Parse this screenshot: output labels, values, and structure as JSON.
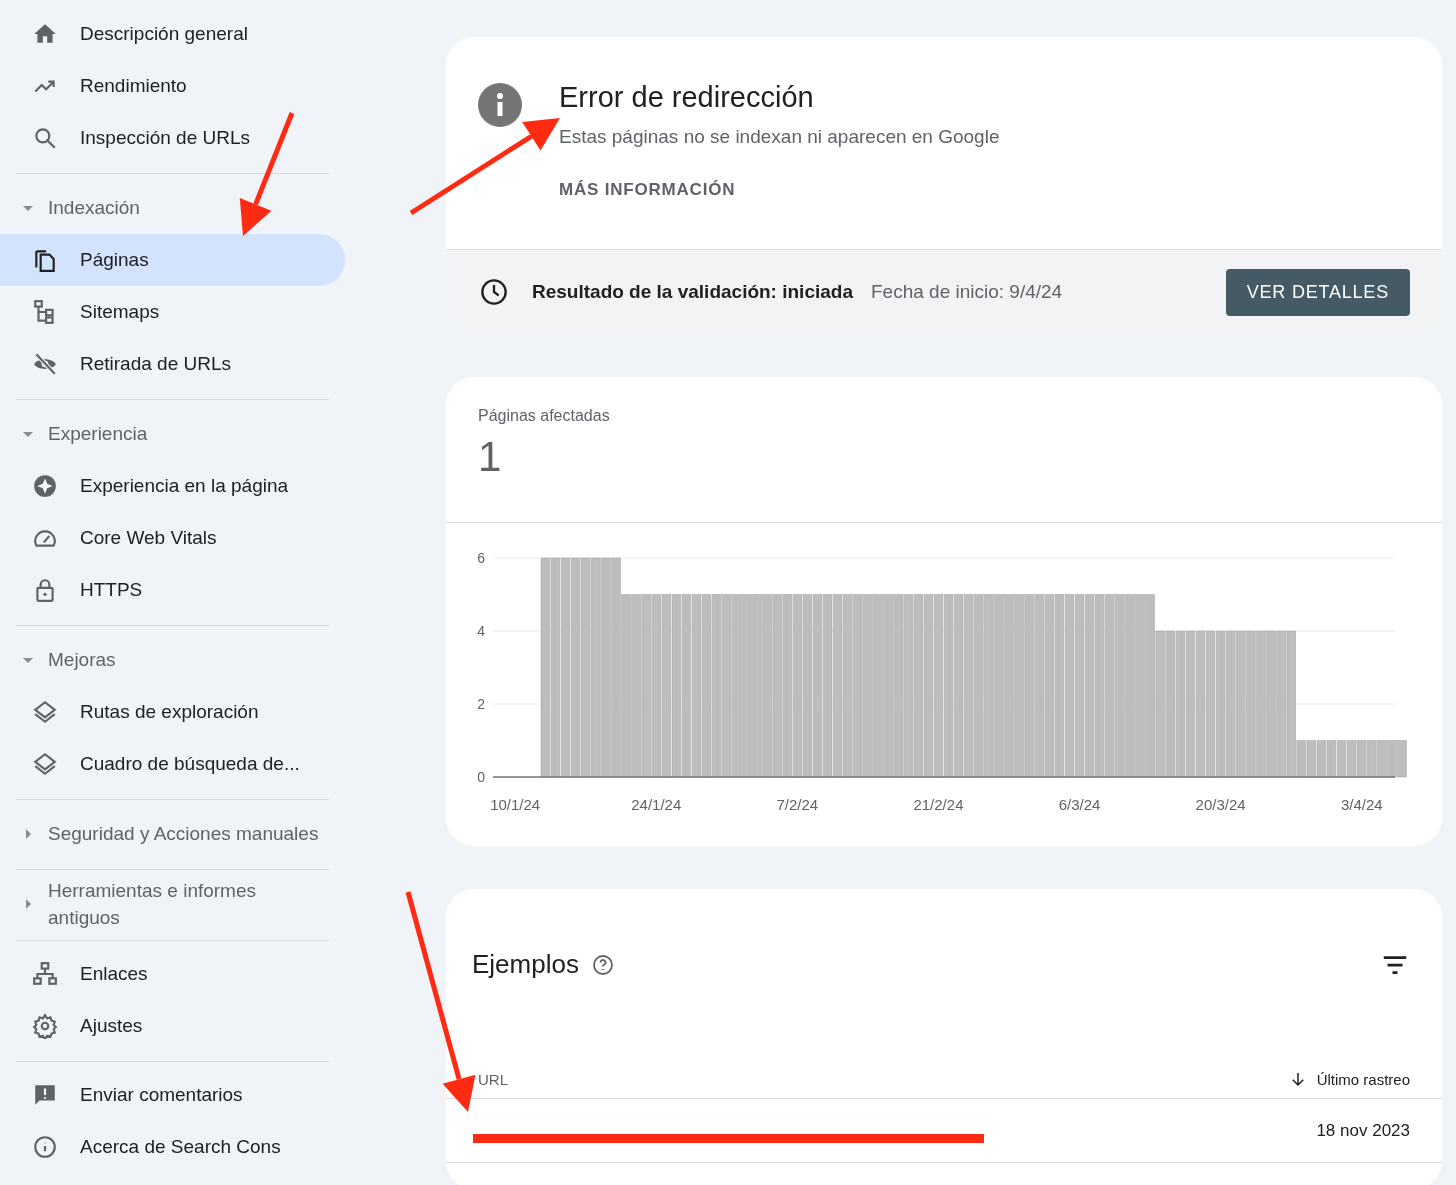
{
  "sidebar": {
    "sections": [
      {
        "items": [
          {
            "label": "Descripción general",
            "selected": false
          },
          {
            "label": "Rendimiento",
            "selected": false
          },
          {
            "label": "Inspección de URLs",
            "selected": false
          }
        ]
      },
      {
        "header": "Indexación",
        "expanded": true,
        "items": [
          {
            "label": "Páginas",
            "selected": true
          },
          {
            "label": "Sitemaps",
            "selected": false
          },
          {
            "label": "Retirada de URLs",
            "selected": false
          }
        ]
      },
      {
        "header": "Experiencia",
        "expanded": true,
        "items": [
          {
            "label": "Experiencia en la página",
            "selected": false
          },
          {
            "label": "Core Web Vitals",
            "selected": false
          },
          {
            "label": "HTTPS",
            "selected": false
          }
        ]
      },
      {
        "header": "Mejoras",
        "expanded": true,
        "items": [
          {
            "label": "Rutas de exploración",
            "selected": false
          },
          {
            "label": "Cuadro de búsqueda de...",
            "selected": false
          }
        ]
      },
      {
        "header": "Seguridad y Acciones manuales",
        "expanded": false
      },
      {
        "header": "Herramientas e informes antiguos",
        "expanded": false
      },
      {
        "items": [
          {
            "label": "Enlaces",
            "selected": false
          },
          {
            "label": "Ajustes",
            "selected": false
          }
        ]
      },
      {
        "items": [
          {
            "label": "Enviar comentarios",
            "selected": false
          },
          {
            "label": "Acerca de Search Cons",
            "selected": false
          }
        ]
      }
    ]
  },
  "issue": {
    "title": "Error de redirección",
    "description": "Estas páginas no se indexan ni aparecen en Google",
    "link": "MÁS INFORMACIÓN",
    "validation": {
      "status": "Resultado de la validación: iniciada",
      "start_date": "Fecha de inicio: 9/4/24",
      "button": "VER DETALLES"
    }
  },
  "affected": {
    "label": "Páginas afectadas",
    "count": "1",
    "chart_data": {
      "type": "bar",
      "categories": [
        "10/1/24",
        null,
        null,
        null,
        null,
        null,
        null,
        null,
        null,
        null,
        null,
        null,
        null,
        null,
        "24/1/24",
        null,
        null,
        null,
        null,
        null,
        null,
        null,
        null,
        null,
        null,
        null,
        null,
        null,
        "7/2/24",
        null,
        null,
        null,
        null,
        null,
        null,
        null,
        null,
        null,
        null,
        null,
        null,
        null,
        "21/2/24",
        null,
        null,
        null,
        null,
        null,
        null,
        null,
        null,
        null,
        null,
        null,
        null,
        null,
        "6/3/24",
        null,
        null,
        null,
        null,
        null,
        null,
        null,
        null,
        null,
        null,
        null,
        null,
        null,
        "20/3/24",
        null,
        null,
        null,
        null,
        null,
        null,
        null,
        null,
        null,
        null,
        null,
        null,
        null,
        "3/4/24",
        null,
        null,
        null,
        null
      ],
      "values": [
        null,
        null,
        null,
        6,
        6,
        6,
        6,
        6,
        6,
        6,
        6,
        5,
        5,
        5,
        5,
        5,
        5,
        5,
        5,
        5,
        5,
        5,
        5,
        5,
        5,
        5,
        5,
        5,
        5,
        5,
        5,
        5,
        5,
        5,
        5,
        5,
        5,
        5,
        5,
        5,
        5,
        5,
        5,
        5,
        5,
        5,
        5,
        5,
        5,
        5,
        5,
        5,
        5,
        5,
        5,
        5,
        5,
        5,
        5,
        5,
        5,
        5,
        5,
        5,
        4,
        4,
        4,
        4,
        4,
        4,
        4,
        4,
        4,
        4,
        4,
        4,
        4,
        4,
        1,
        1,
        1,
        1,
        1,
        1,
        1,
        1,
        1,
        1,
        1
      ],
      "ylim": [
        0,
        6
      ],
      "yticks": [
        0,
        2,
        4,
        6
      ]
    }
  },
  "examples": {
    "title": "Ejemplos",
    "columns": [
      {
        "label": "URL",
        "sorted": false
      },
      {
        "label": "Último rastreo",
        "sorted": true
      }
    ],
    "rows": [
      {
        "date": "18 nov 2023"
      }
    ]
  }
}
